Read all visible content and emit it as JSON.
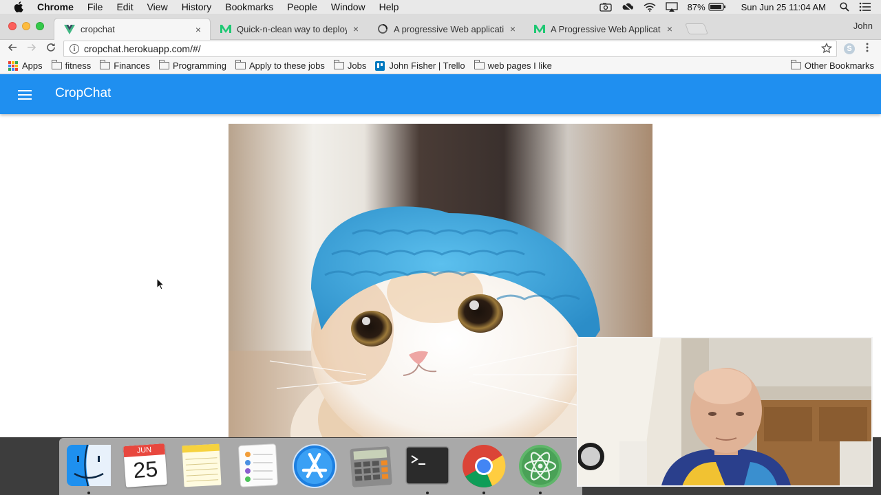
{
  "menubar": {
    "app_name": "Chrome",
    "menus": [
      "File",
      "Edit",
      "View",
      "History",
      "Bookmarks",
      "People",
      "Window",
      "Help"
    ],
    "battery": "87%",
    "clock": "Sun Jun 25  11:04 AM",
    "user": "John"
  },
  "tabs": [
    {
      "title": "cropchat",
      "active": true
    },
    {
      "title": "Quick-n-clean way to deploy V"
    },
    {
      "title": "A progressive Web application"
    },
    {
      "title": "A Progressive Web Application"
    }
  ],
  "address_bar": {
    "url": "cropchat.herokuapp.com/#/"
  },
  "bookmarks": {
    "items": [
      "Apps",
      "fitness",
      "Finances",
      "Programming",
      "Apply to these jobs",
      "Jobs",
      "John Fisher | Trello",
      "web pages I like"
    ],
    "other": "Other Bookmarks"
  },
  "app": {
    "title": "CropChat",
    "accent_color": "#1f8ff0"
  },
  "dock": {
    "calendar_month": "JUN",
    "calendar_day": "25"
  }
}
